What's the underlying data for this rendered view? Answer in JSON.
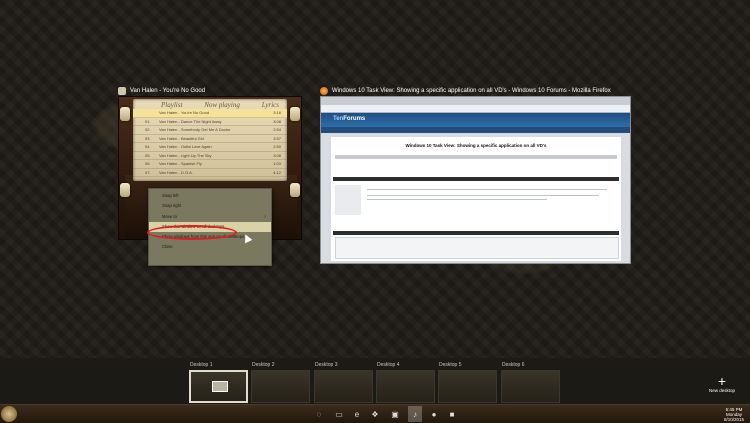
{
  "windows": {
    "player": {
      "title": "Van Halen - You're No Good",
      "headers": [
        "Playlist",
        "Now playing",
        "Lyrics"
      ],
      "tracks": [
        {
          "num": "",
          "title": "Van Halen - You're No Good",
          "time": "3:16"
        },
        {
          "num": "01.",
          "title": "Van Halen - Dance The Night Away",
          "time": "3:08"
        },
        {
          "num": "02.",
          "title": "Van Halen - Somebody Get Me A Doctor",
          "time": "2:54"
        },
        {
          "num": "03.",
          "title": "Van Halen - Beautiful Girl",
          "time": "3:57"
        },
        {
          "num": "04.",
          "title": "Van Halen - Outta Love Again",
          "time": "2:50"
        },
        {
          "num": "05.",
          "title": "Van Halen - Light Up The Sky",
          "time": "3:08"
        },
        {
          "num": "06.",
          "title": "Van Halen - Spanish Fly",
          "time": "1:03"
        },
        {
          "num": "07.",
          "title": "Van Halen - D.O.A.",
          "time": "4:12"
        }
      ]
    },
    "firefox": {
      "title": "Windows 10 Task View: Showing a specific application on all VD's - Windows 10 Forums - Mozilla Firefox",
      "logo_a": "Ten",
      "logo_b": "Forums",
      "page_title": "Windows 10 Task View: Showing a specific application on all VD's"
    }
  },
  "context_menu": {
    "items": [
      {
        "label": "Snap left"
      },
      {
        "label": "Snap right"
      },
      {
        "label": "Move to"
      },
      {
        "label": "Show this window on all desktops"
      },
      {
        "label": "Show windows from this app on all desktops"
      },
      {
        "label": "Close"
      }
    ]
  },
  "desktops": [
    {
      "label": "Desktop 1"
    },
    {
      "label": "Desktop 2"
    },
    {
      "label": "Desktop 3"
    },
    {
      "label": "Desktop 4"
    },
    {
      "label": "Desktop 5"
    },
    {
      "label": "Desktop 6"
    }
  ],
  "new_desktop": {
    "plus": "+",
    "label": "New desktop"
  },
  "clock": {
    "time": "6:45 PM",
    "day": "Monday",
    "date": "8/10/2015"
  },
  "colors": {
    "highlight_ring": "#e21b1b",
    "menu_bg": "#7b7860",
    "menu_highlight": "#d8d2a6"
  }
}
